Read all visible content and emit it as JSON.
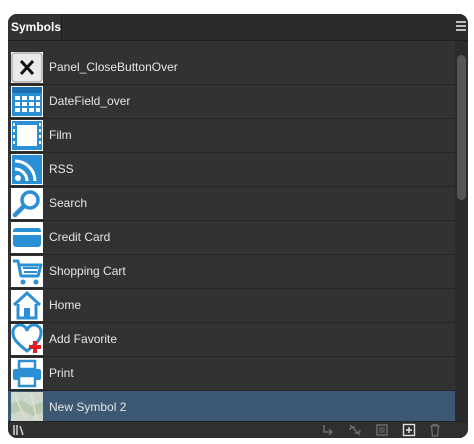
{
  "panel": {
    "tab_label": "Symbols"
  },
  "symbols": [
    {
      "label": "Panel_CloseButtonOver",
      "icon": "close-x-icon"
    },
    {
      "label": "DateField_over",
      "icon": "calendar-grid-icon"
    },
    {
      "label": "Film",
      "icon": "film-icon"
    },
    {
      "label": "RSS",
      "icon": "rss-icon"
    },
    {
      "label": "Search",
      "icon": "magnifier-icon"
    },
    {
      "label": "Credit Card",
      "icon": "credit-card-icon"
    },
    {
      "label": "Shopping Cart",
      "icon": "shopping-cart-icon"
    },
    {
      "label": "Home",
      "icon": "home-icon"
    },
    {
      "label": "Add Favorite",
      "icon": "heart-plus-icon"
    },
    {
      "label": "Print",
      "icon": "printer-icon"
    },
    {
      "label": "New Symbol 2",
      "icon": "map-thumbnail-icon",
      "selected": true
    }
  ],
  "footer_icons": [
    "libraries-icon",
    "place-symbol-icon",
    "break-link-icon",
    "symbol-options-icon",
    "new-symbol-icon",
    "delete-icon"
  ],
  "colors": {
    "panel_bg": "#323232",
    "selection": "#3d5873",
    "icon_blue": "#2b8fd6",
    "text": "#e6e6e6"
  }
}
